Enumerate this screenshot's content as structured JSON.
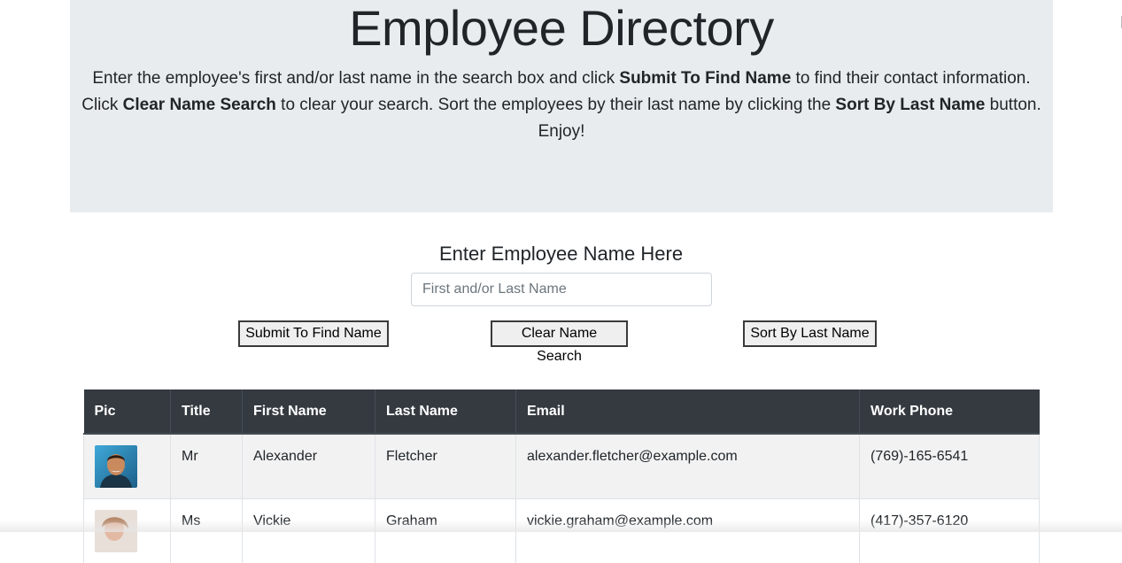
{
  "jumbotron": {
    "title": "Employee Directory",
    "line1_a": "Enter the employee's first and/or last name in the search box and click ",
    "line1_b": "Submit To Find Name",
    "line1_c": " to find their contact information.",
    "line2_a": "Click ",
    "line2_b": "Clear Name Search",
    "line2_c": " to clear your search. Sort the employees by their last name by clicking the ",
    "line2_d": "Sort By Last Name",
    "line2_e": " button.",
    "line3": "Enjoy!"
  },
  "search": {
    "heading": "Enter Employee Name Here",
    "placeholder": "First and/or Last Name",
    "value": "",
    "submit_label": "Submit To Find Name",
    "clear_label": "Clear Name Search",
    "sort_label": "Sort By Last Name"
  },
  "table": {
    "headers": [
      "Pic",
      "Title",
      "First Name",
      "Last Name",
      "Email",
      "Work Phone"
    ],
    "rows": [
      {
        "title": "Mr",
        "first": "Alexander",
        "last": "Fletcher",
        "email": "alexander.fletcher@example.com",
        "phone": "(769)-165-6541"
      },
      {
        "title": "Ms",
        "first": "Vickie",
        "last": "Graham",
        "email": "vickie.graham@example.com",
        "phone": "(417)-357-6120"
      }
    ]
  },
  "colors": {
    "jumbotron_bg": "#e9ecef",
    "table_header_bg": "#343a40",
    "row_stripe": "#f2f2f2"
  }
}
